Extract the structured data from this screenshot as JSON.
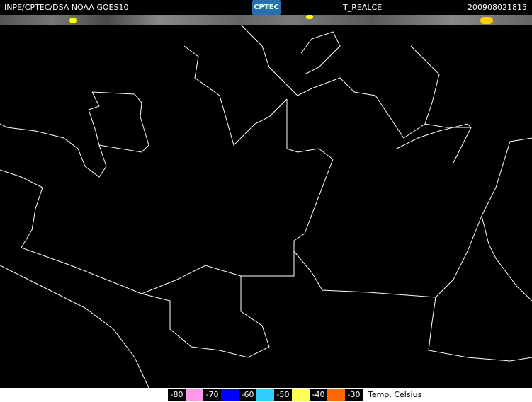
{
  "header": {
    "source": "INPE/CPTEC/DSA NOAA GOES10",
    "logo": "CPTEC",
    "product": "T_REALCE",
    "timestamp": "200908021815"
  },
  "legend": {
    "items": [
      {
        "label": "-80",
        "color": "#ff99ee"
      },
      {
        "label": "-70",
        "color": "#0000ff"
      },
      {
        "label": "-60",
        "color": "#33ccff"
      },
      {
        "label": "-50",
        "color": "#ffff55"
      },
      {
        "label": "-40",
        "color": "#ff6600"
      },
      {
        "label": "-30",
        "color": null
      }
    ],
    "unit": "Temp. Celsius"
  }
}
